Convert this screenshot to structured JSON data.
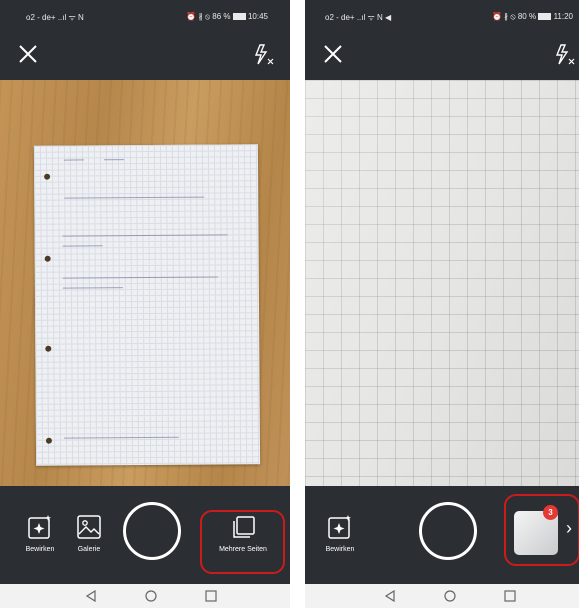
{
  "left_screen": {
    "status": {
      "carrier": "o2 - de+",
      "signal_text": "..ıl ᯤ N",
      "icons_text": "⏰ ∦ ⦸",
      "battery": "86 %",
      "time": "10:45"
    },
    "tools": {
      "enhance_label": "Bewirken",
      "gallery_label": "Galerie",
      "multi_page_label": "Mehrere Seiten"
    },
    "highlight_color": "#cc1b1b"
  },
  "right_screen": {
    "status": {
      "carrier": "o2 - de+",
      "signal_text": "..ıl ᯤ N ◀",
      "icons_text": "⏰ ∦ ⦸",
      "battery": "80 %",
      "time": "11:20"
    },
    "tools": {
      "enhance_label": "Bewirken"
    },
    "thumbnail_badge": "3",
    "highlight_color": "#cc1b1b"
  }
}
